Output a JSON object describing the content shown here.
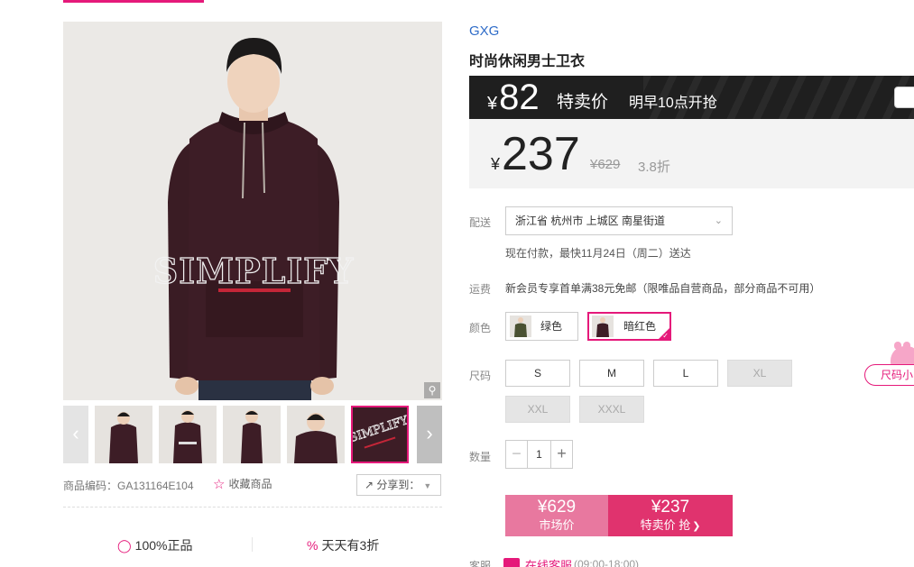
{
  "gallery": {
    "thumb_count": 5,
    "zoom_icon": "magnifier-icon",
    "thumb_prev_icon": "chevron-left-icon",
    "thumb_next_icon": "chevron-right-icon"
  },
  "product": {
    "brand": "GXG",
    "title": "时尚休闲男士卫衣",
    "print_text": "SIMPLIFY",
    "sku_code": "商品编码：GA131164E104",
    "favorite_label": "收藏商品",
    "share_label": "分享到："
  },
  "flash_sale": {
    "currency": "¥",
    "price": "82",
    "label": "特卖价",
    "start_time": "明早10点开抢"
  },
  "pricing": {
    "currency": "¥",
    "sale_price": "237",
    "original_price": "¥629",
    "discount": "3.8折"
  },
  "delivery": {
    "label": "配送",
    "address": "浙江省 杭州市 上城区 南星街道",
    "note": "现在付款，最快11月24日（周二）送达"
  },
  "shipping": {
    "label": "运费",
    "text": "新会员专享首单满38元免邮（限唯品自营商品，部分商品不可用）"
  },
  "colors": {
    "label": "颜色",
    "options": [
      {
        "name": "绿色",
        "selected": false
      },
      {
        "name": "暗红色",
        "selected": true
      }
    ]
  },
  "sizes": {
    "label": "尺码",
    "options": [
      {
        "name": "S",
        "available": true
      },
      {
        "name": "M",
        "available": true
      },
      {
        "name": "L",
        "available": true
      },
      {
        "name": "XL",
        "available": false
      },
      {
        "name": "XXL",
        "available": false
      },
      {
        "name": "XXXL",
        "available": false
      }
    ],
    "helper_label": "尺码小"
  },
  "quantity": {
    "label": "数量",
    "value": "1",
    "minus": "−",
    "plus": "+"
  },
  "buy": {
    "market_price": "¥629",
    "market_label": "市场价",
    "special_price": "¥237",
    "special_label": "特卖价 抢"
  },
  "customer_service": {
    "label": "客服",
    "link": "在线客服",
    "hours": "(09:00-18:00)"
  },
  "promises": [
    {
      "text": "100%正品",
      "icon": "shield-check-icon"
    },
    {
      "text": "天天有3折",
      "icon": "percent-badge-icon"
    }
  ],
  "colors_theme": {
    "accent": "#e5197a",
    "link": "#2f6cc8",
    "flash_bg": "#1f1f1f",
    "buy_market": "#e8789f",
    "buy_special": "#e0336e",
    "hoodie": "#3a1c24"
  }
}
